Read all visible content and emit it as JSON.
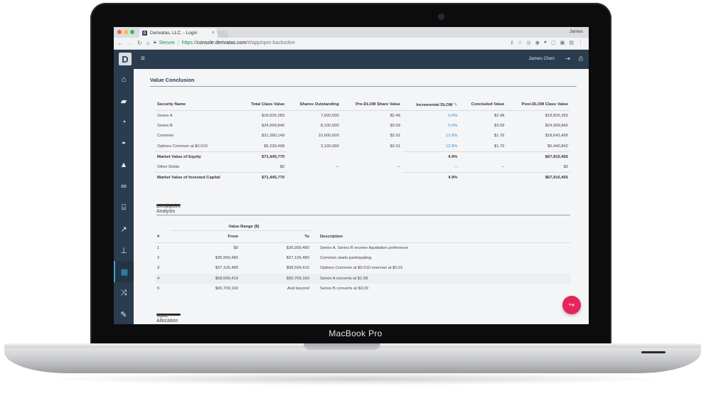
{
  "device": {
    "brand": "MacBook Pro"
  },
  "browser": {
    "tab_title": "Derivatas, LLC. - Login",
    "tab_favicon": "D",
    "profile": "James",
    "secure_label": "Secure",
    "url_protocol": "https://",
    "url_host": "console.derivatas.com",
    "url_path": "/#/app/opm-backsolve"
  },
  "app": {
    "logo": "D",
    "user": "James Chen",
    "colors": {
      "nav": "#2b3c4e",
      "accent": "#31a6d8",
      "link": "#2d8fd6",
      "fab": "#e8245a"
    }
  },
  "sidebar": {
    "items": [
      {
        "icon": "home-icon"
      },
      {
        "icon": "folder-open-icon"
      },
      {
        "icon": "pie-chart-icon"
      },
      {
        "icon": "dashboard-icon"
      },
      {
        "icon": "graduation-cap-icon"
      },
      {
        "icon": "bicycle-icon"
      },
      {
        "icon": "bank-icon"
      },
      {
        "icon": "line-chart-icon"
      },
      {
        "icon": "sitemap-icon"
      },
      {
        "icon": "calculator-icon",
        "active": true
      },
      {
        "icon": "random-icon"
      },
      {
        "icon": "wrench-icon"
      }
    ]
  },
  "value_conclusion": {
    "title": "Value Conclusion",
    "headers": [
      "Security Name",
      "Total Class Value",
      "Shares Outstanding",
      "Pre-DLOM Share Value",
      "Incremental DLOM",
      "Concluded Value",
      "Post-DLOM Class Value"
    ],
    "rows": [
      [
        "Series A",
        "$18,826,283",
        "7,600,000",
        "$2.48",
        "0.0%",
        "$2.48",
        "$18,826,283"
      ],
      [
        "Series B",
        "$24,999,840",
        "8,100,000",
        "$3.09",
        "0.0%",
        "$3.09",
        "$24,999,840"
      ],
      [
        "Common",
        "$21,380,149",
        "10,600,000",
        "$2.02",
        "12.8%",
        "$1.76",
        "$18,643,490"
      ],
      [
        "Options Common at $0.010",
        "$6,239,498",
        "3,100,000",
        "$2.01",
        "12.8%",
        "$1.76",
        "$5,440,842"
      ]
    ],
    "equity_row": [
      "Market Value of Equity",
      "$71,445,770",
      "",
      "",
      "4.9%",
      "",
      "$67,910,455"
    ],
    "debt_row": [
      "Other Debts",
      "$0",
      "--",
      "--",
      "--",
      "--",
      "$0"
    ],
    "invested_row": [
      "Market Value of Invested Capital",
      "$71,445,770",
      "",
      "",
      "4.9%",
      "",
      "$67,910,455"
    ]
  },
  "breakpoint": {
    "title": "Breakpoint Analysis",
    "group_header": "Value Range ($)",
    "headers": [
      "#",
      "From",
      "To",
      "Description"
    ],
    "rows": [
      [
        "1",
        "$0",
        "$36,999,480",
        "Series A, Series B receive liquidation preference"
      ],
      [
        "2",
        "$36,999,480",
        "$37,105,480",
        "Common starts participating"
      ],
      [
        "3",
        "$37,105,480",
        "$58,599,410",
        "Options Common at $0.010 exercise at $0.01"
      ],
      [
        "4",
        "$58,599,410",
        "$90,709,160",
        "Series A converts at $1.58"
      ],
      [
        "5",
        "$90,709,160",
        "And beyond",
        "Series B converts at $3.09"
      ]
    ]
  },
  "value_allocation": {
    "title": "Value Allocation"
  }
}
